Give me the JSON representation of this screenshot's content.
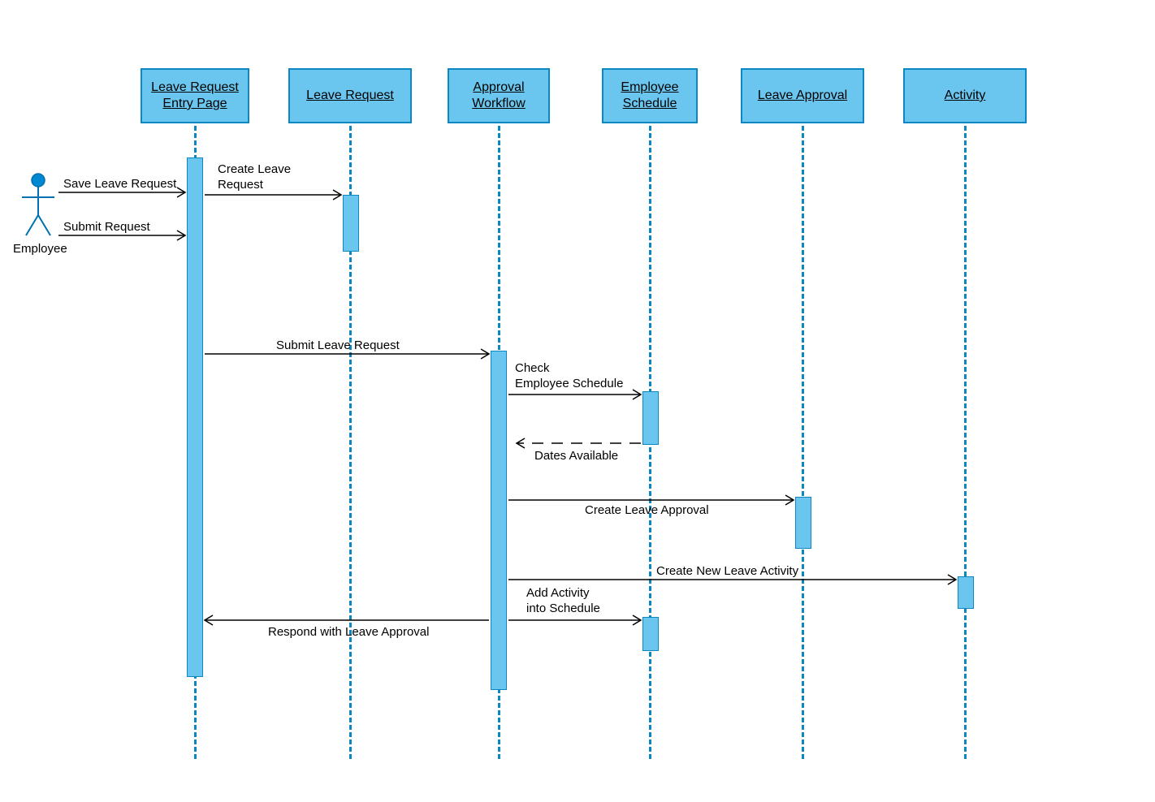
{
  "actor": {
    "label": "Employee"
  },
  "participants": {
    "entryPage": "Leave Request\nEntry Page",
    "leaveRequest": "Leave Request",
    "approvalWorkflow": "Approval\nWorkflow",
    "employeeSchedule": "Employee\nSchedule",
    "leaveApproval": "Leave Approval",
    "activity": "Activity"
  },
  "messages": {
    "saveLeaveRequest": "Save Leave Request",
    "submitRequest": "Submit  Request",
    "createLeaveRequest": "Create Leave\nRequest",
    "submitLeaveRequest": "Submit  Leave Request",
    "checkEmployeeSchedule": "Check\nEmployee Schedule",
    "datesAvailable": "Dates Available",
    "createLeaveApproval": "Create Leave Approval",
    "createNewLeaveActivity": "Create New Leave Activity",
    "addActivityIntoSchedule": "Add Activity\ninto Schedule",
    "respondWithLeaveApproval": "Respond with Leave Approval"
  },
  "colors": {
    "fill": "#6bc6ef",
    "stroke": "#0b88c2"
  }
}
